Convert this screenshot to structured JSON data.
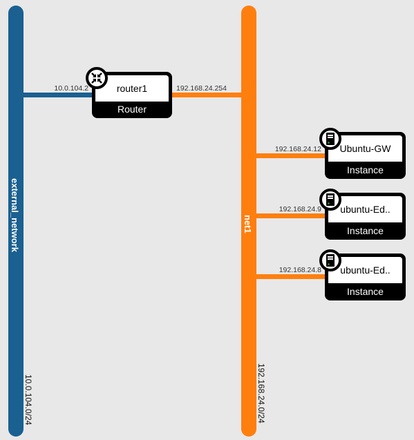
{
  "networks": [
    {
      "name": "external_network",
      "cidr": "10.0.104.0/24",
      "color": "#1a6091"
    },
    {
      "name": "net1",
      "cidr": "192.168.24.0/24",
      "color": "#ff7f0e"
    }
  ],
  "router": {
    "name": "router1",
    "type": "Router",
    "icon": "router-arrows-icon",
    "external_ip": "10.0.104.2",
    "internal_ip": "192.168.24.254"
  },
  "instances": [
    {
      "name": "Ubuntu-GW",
      "type": "Instance",
      "ip": "192.168.24.12",
      "icon": "server-icon"
    },
    {
      "name": "ubuntu-Ed..",
      "type": "Instance",
      "ip": "192.168.24.9",
      "icon": "server-icon"
    },
    {
      "name": "ubuntu-Ed..",
      "type": "Instance",
      "ip": "192.168.24.8",
      "icon": "server-icon"
    }
  ]
}
